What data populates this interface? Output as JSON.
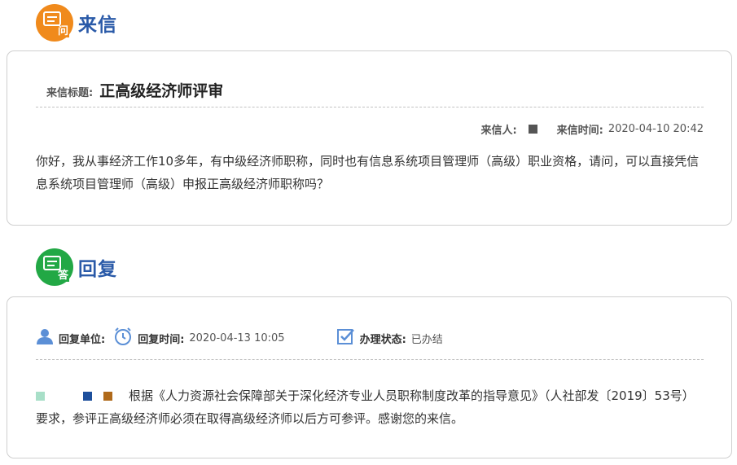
{
  "letter_section": {
    "title": "来信",
    "badge_glyph": "问"
  },
  "letter": {
    "title_label": "来信标题:",
    "title": "正高级经济师评审",
    "sender_label": "来信人:",
    "time_label": "来信时间:",
    "time": "2020-04-10 20:42",
    "content": "你好，我从事经济工作10多年，有中级经济师职称，同时也有信息系统项目管理师（高级）职业资格，请问，可以直接凭信息系统项目管理师（高级）申报正高级经济师职称吗？"
  },
  "reply_section": {
    "title": "回复",
    "badge_glyph": "答"
  },
  "reply": {
    "unit_label": "回复单位:",
    "time_label": "回复时间:",
    "time": "2020-04-13 10:05",
    "status_label": "办理状态:",
    "status": "已办结",
    "content": "根据《人力资源社会保障部关于深化经济专业人员职称制度改革的指导意见》（人社部发〔2019〕53号）要求，参评正高级经济师必须在取得高级经济师以后方可参评。感谢您的来信。"
  },
  "colors": {
    "letter_badge": "#f08a1c",
    "reply_badge": "#22a845",
    "section_title": "#2a5aa8",
    "icon_blue": "#5b8fd6"
  }
}
